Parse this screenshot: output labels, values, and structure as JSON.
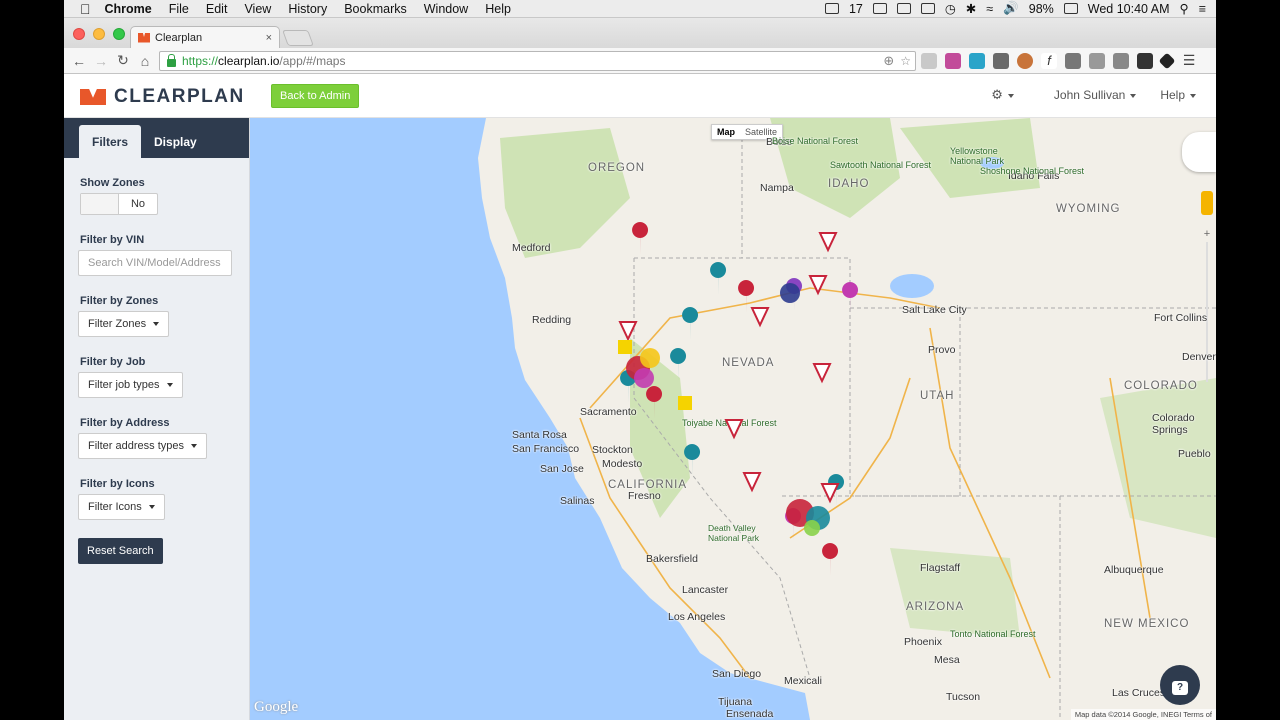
{
  "menubar": {
    "apple": "",
    "items": [
      "Chrome",
      "File",
      "Edit",
      "View",
      "History",
      "Bookmarks",
      "Window",
      "Help"
    ],
    "status": {
      "num": "17",
      "battery": "98%",
      "clock": "Wed 10:40 AM"
    }
  },
  "browser": {
    "tab_title": "Clearplan",
    "tab_close": "×",
    "url_scheme": "https://",
    "url_host": "clearplan.io",
    "url_path": "/app/#/maps"
  },
  "app": {
    "logo_text": "CLEARPLAN",
    "back_to_admin": "Back to Admin",
    "user": "John Sullivan",
    "help": "Help"
  },
  "sidebar": {
    "tabs": [
      "Filters",
      "Display"
    ],
    "show_zones_label": "Show Zones",
    "show_zones_value": "No",
    "vin_label": "Filter by VIN",
    "vin_placeholder": "Search VIN/Model/Address",
    "zones_label": "Filter by Zones",
    "zones_button": "Filter Zones",
    "job_label": "Filter by Job",
    "job_button": "Filter job types",
    "address_label": "Filter by Address",
    "address_button": "Filter address types",
    "icons_label": "Filter by Icons",
    "icons_button": "Filter Icons",
    "reset": "Reset Search"
  },
  "map": {
    "type_map": "Map",
    "type_satellite": "Satellite",
    "google": "Google",
    "attribution": "Map data ©2014 Google, INEGI   Terms of",
    "states": [
      "OREGON",
      "IDAHO",
      "WYOMING",
      "NEVADA",
      "UTAH",
      "COLORADO",
      "CALIFORNIA",
      "ARIZONA",
      "NEW MEXICO"
    ],
    "cities": [
      "Boise",
      "Nampa",
      "Medford",
      "Redding",
      "Salt Lake City",
      "Provo",
      "Fort Collins",
      "Denver",
      "Colorado Springs",
      "Sacramento",
      "Santa Rosa",
      "San Francisco",
      "Stockton",
      "San Jose",
      "Modesto",
      "Salinas",
      "Fresno",
      "Bakersfield",
      "Lancaster",
      "Los Angeles",
      "San Diego",
      "Tijuana",
      "Mexicali",
      "Ensenada",
      "Flagstaff",
      "Phoenix",
      "Mesa",
      "Tucson",
      "Albuquerque",
      "Las Cruces",
      "Idaho Falls",
      "Pueblo"
    ],
    "parks": [
      "Boise National Forest",
      "Sawtooth National Forest",
      "Yellowstone National Park",
      "Shoshone National Forest",
      "Toiyabe National Forest",
      "Death Valley National Park",
      "Tonto National Forest"
    ]
  }
}
